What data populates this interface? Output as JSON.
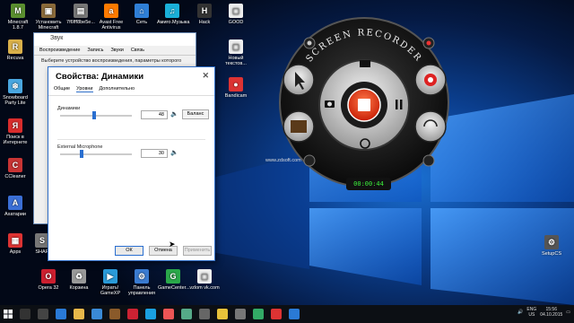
{
  "desktop": {
    "icons": [
      {
        "label": "Minecraft 1.8.7",
        "color": "#5a8f2f",
        "glyph": "M"
      },
      {
        "label": "Установить Minecraft",
        "color": "#8a6a3a",
        "glyph": "▣"
      },
      {
        "label": "7f6fff8be5e...",
        "color": "#777",
        "glyph": "▤"
      },
      {
        "label": "Avast Free Antivirus",
        "color": "#ff7a00",
        "glyph": "a"
      },
      {
        "label": "Сеть",
        "color": "#2f7fd6",
        "glyph": "⌂"
      },
      {
        "label": "Амиго.Музыка",
        "color": "#1ab0d9",
        "glyph": "♫"
      },
      {
        "label": "Hack",
        "color": "#333",
        "glyph": "H"
      },
      {
        "label": "GOOD",
        "color": "#eee",
        "glyph": "▢"
      },
      {
        "label": "Recuva",
        "color": "#d9b04a",
        "glyph": "R"
      },
      {
        "label": "Snowboard Party Lite",
        "color": "#4aa7e0",
        "glyph": "❄"
      },
      {
        "label": "Поиск в Интернете",
        "color": "#d92c2c",
        "glyph": "Я"
      },
      {
        "label": "CCleaner",
        "color": "#c83434",
        "glyph": "C"
      },
      {
        "label": "Ахатарии",
        "color": "#3b6fd6",
        "glyph": "A"
      },
      {
        "label": "Apps",
        "color": "#d33",
        "glyph": "▦"
      },
      {
        "label": "SHAR",
        "color": "#777",
        "glyph": "S"
      },
      {
        "label": "Opera 32",
        "color": "#cc1f2f",
        "glyph": "O"
      },
      {
        "label": "Корзина",
        "color": "#999",
        "glyph": "🗑"
      },
      {
        "label": "Играть! GameXP",
        "color": "#2a9ad8",
        "glyph": "▶"
      },
      {
        "label": "Панель управления",
        "color": "#3a7bd0",
        "glyph": "⚙"
      },
      {
        "label": "GameCenter...",
        "color": "#2aa84a",
        "glyph": "G"
      },
      {
        "label": "vzlom vk.com",
        "color": "#eee",
        "glyph": "▢"
      },
      {
        "label": "Новый текстов...",
        "color": "#eee",
        "glyph": "▢"
      },
      {
        "label": "Bandicam",
        "color": "#d33",
        "glyph": "●"
      },
      {
        "label": "SetupCS",
        "color": "#555",
        "glyph": "⚙"
      }
    ]
  },
  "sound_window": {
    "title": "Звук",
    "tabs": [
      "Воспроизведение",
      "Запись",
      "Звуки",
      "Связь"
    ],
    "description": "Выберите устройство воспроизведения, параметры которого"
  },
  "props_dialog": {
    "title": "Свойства: Динамики",
    "tabs": [
      "Общие",
      "Уровни",
      "Дополнительно"
    ],
    "rows": [
      {
        "label": "Динамики",
        "value": "48",
        "balance": "Баланс",
        "level": 0.48
      },
      {
        "label": "External Microphone",
        "value": "30",
        "level": 0.3
      }
    ],
    "buttons": {
      "ok": "ОК",
      "cancel": "Отмена",
      "apply": "Применить"
    }
  },
  "recorder": {
    "brand": "SCREEN RECORDER",
    "timer": "00:00:44",
    "site": "www.zdsoft.com"
  },
  "tray": {
    "lang": "ENG",
    "region": "US",
    "time": "15:56",
    "date": "04.10.2015"
  }
}
